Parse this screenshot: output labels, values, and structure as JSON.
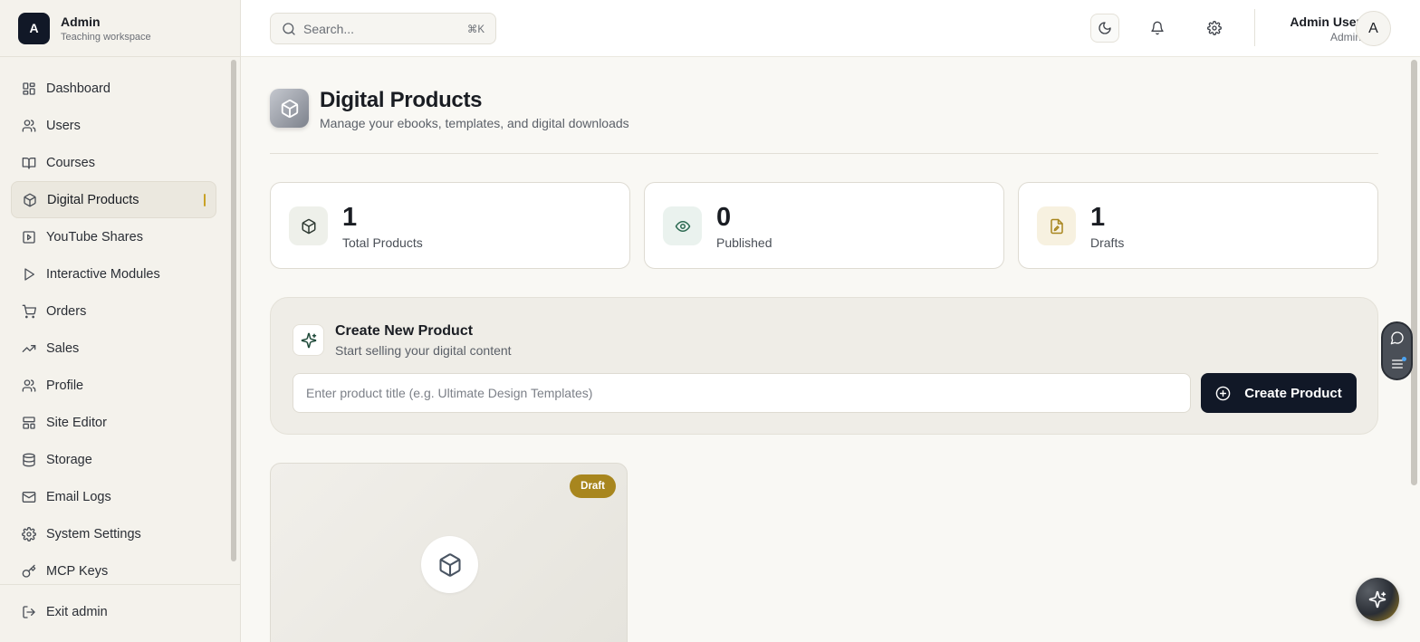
{
  "brand": {
    "initial": "A",
    "title": "Admin",
    "subtitle": "Teaching workspace"
  },
  "sidebar": {
    "items": [
      {
        "label": "Dashboard",
        "icon": "dashboard-icon"
      },
      {
        "label": "Users",
        "icon": "users-icon"
      },
      {
        "label": "Courses",
        "icon": "book-icon"
      },
      {
        "label": "Digital Products",
        "icon": "package-icon",
        "active": true
      },
      {
        "label": "YouTube Shares",
        "icon": "youtube-icon"
      },
      {
        "label": "Interactive Modules",
        "icon": "play-icon"
      },
      {
        "label": "Orders",
        "icon": "cart-icon"
      },
      {
        "label": "Sales",
        "icon": "trending-icon"
      },
      {
        "label": "Profile",
        "icon": "user-icon"
      },
      {
        "label": "Site Editor",
        "icon": "layout-icon"
      },
      {
        "label": "Storage",
        "icon": "database-icon"
      },
      {
        "label": "Email Logs",
        "icon": "mail-icon"
      },
      {
        "label": "System Settings",
        "icon": "gear-icon"
      },
      {
        "label": "MCP Keys",
        "icon": "key-icon"
      }
    ],
    "exit_label": "Exit admin"
  },
  "header": {
    "search_placeholder": "Search...",
    "search_shortcut": "⌘K",
    "user_name": "Admin User",
    "user_role": "Admin",
    "avatar_initial": "A"
  },
  "page": {
    "title": "Digital Products",
    "subtitle": "Manage your ebooks, templates, and digital downloads"
  },
  "stats": [
    {
      "value": "1",
      "label": "Total Products",
      "icon": "package-icon",
      "bg": "#eef0ea",
      "color": "#2f3a33"
    },
    {
      "value": "0",
      "label": "Published",
      "icon": "eye-icon",
      "bg": "#eaf2ee",
      "color": "#2d6a52"
    },
    {
      "value": "1",
      "label": "Drafts",
      "icon": "file-edit-icon",
      "bg": "#f7f1e0",
      "color": "#a8861e"
    }
  ],
  "create": {
    "title": "Create New Product",
    "subtitle": "Start selling your digital content",
    "input_placeholder": "Enter product title (e.g. Ultimate Design Templates)",
    "button_label": "Create Product"
  },
  "products": [
    {
      "status": "Draft"
    }
  ]
}
